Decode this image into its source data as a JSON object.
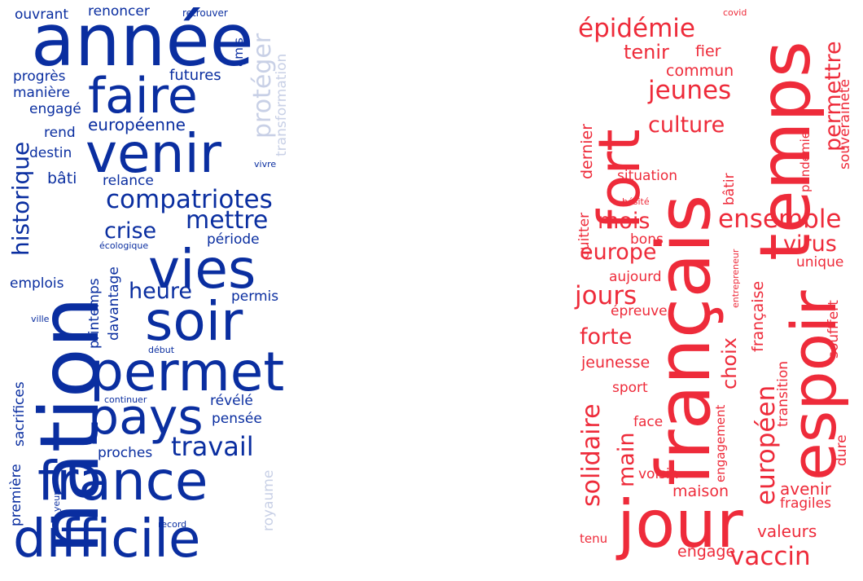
{
  "clouds": [
    {
      "id": "left",
      "color": "#0a2ea0",
      "light_color": "#c8d0e6",
      "words": [
        "année",
        "faire",
        "venir",
        "nation",
        "vies",
        "soir",
        "permet",
        "pays",
        "france",
        "difficile",
        "compatriotes",
        "mettre",
        "travail",
        "historique",
        "crise",
        "heure",
        "protéger",
        "transformation",
        "européenne",
        "futures",
        "ouvrant",
        "renoncer",
        "retrouver",
        "amis",
        "progrès",
        "manière",
        "engagé",
        "rend",
        "destin",
        "bâti",
        "relance",
        "vivre",
        "période",
        "écologique",
        "printemps",
        "davantage",
        "emplois",
        "permis",
        "ville",
        "début",
        "sacrifices",
        "continuer",
        "révélé",
        "pensée",
        "proches",
        "première",
        "yeux",
        "royaume",
        "record"
      ]
    },
    {
      "id": "right",
      "color": "#ee2b3a",
      "words": [
        "temps",
        "français",
        "fort",
        "espoir",
        "jour",
        "épidémie",
        "covid",
        "tenir",
        "fier",
        "jeunes",
        "commun",
        "culture",
        "permettre",
        "souveraineté",
        "dernier",
        "situation",
        "hésité",
        "bâtir",
        "pandémie",
        "mois",
        "ensemble",
        "europe",
        "virus",
        "quitter",
        "bons",
        "unique",
        "aujourd",
        "entrepreneur",
        "française",
        "jours",
        "épreuve",
        "forte",
        "choix",
        "soufffert",
        "jeunesse",
        "européen",
        "solidaire",
        "sport",
        "transition",
        "main",
        "face",
        "engagement",
        "dure",
        "voisin",
        "avenir",
        "maison",
        "fragiles",
        "valeurs",
        "tenu",
        "engage",
        "vaccin"
      ]
    }
  ]
}
